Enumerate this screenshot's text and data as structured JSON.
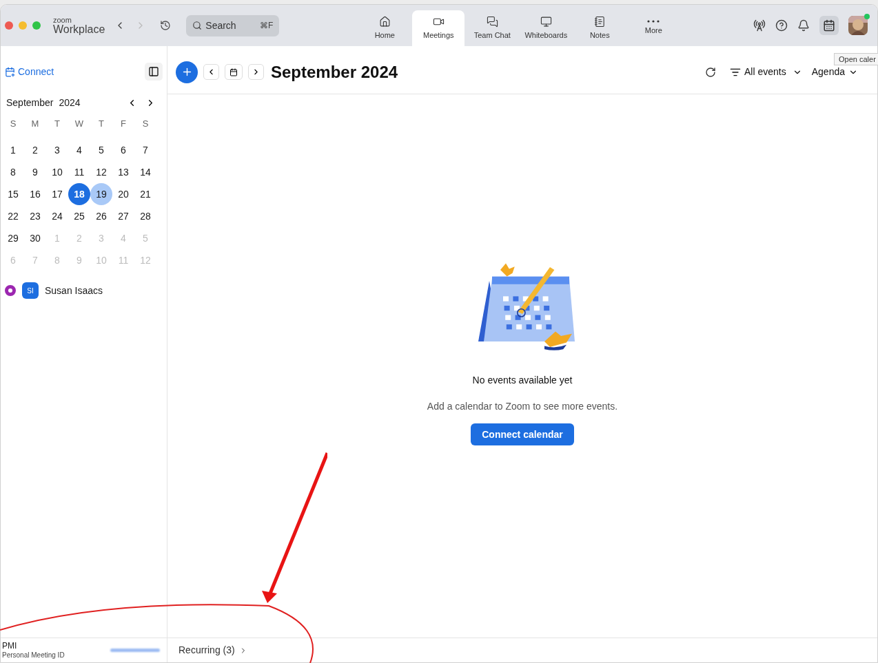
{
  "titlebar": {
    "logo_small": "zoom",
    "logo": "Workplace",
    "search": {
      "placeholder": "Search",
      "shortcut": "⌘F"
    },
    "tabs": [
      {
        "label": "Home",
        "selected": false
      },
      {
        "label": "Meetings",
        "selected": true
      },
      {
        "label": "Team Chat",
        "selected": false
      },
      {
        "label": "Whiteboards",
        "selected": false
      },
      {
        "label": "Notes",
        "selected": false
      },
      {
        "label": "More",
        "selected": false
      }
    ],
    "calendar_button_selected": true,
    "online": true
  },
  "tooltip": "Open caler",
  "sidebar": {
    "connect": "Connect",
    "month": "September",
    "year": "2024",
    "weekdays": [
      "S",
      "M",
      "T",
      "W",
      "T",
      "F",
      "S"
    ],
    "weeks": [
      [
        {
          "label": "1",
          "outside": false,
          "today": false,
          "selected": false
        },
        {
          "label": "2",
          "outside": false,
          "today": false,
          "selected": false
        },
        {
          "label": "3",
          "outside": false,
          "today": false,
          "selected": false
        },
        {
          "label": "4",
          "outside": false,
          "today": false,
          "selected": false
        },
        {
          "label": "5",
          "outside": false,
          "today": false,
          "selected": false
        },
        {
          "label": "6",
          "outside": false,
          "today": false,
          "selected": false
        },
        {
          "label": "7",
          "outside": false,
          "today": false,
          "selected": false
        }
      ],
      [
        {
          "label": "8",
          "outside": false,
          "today": false,
          "selected": false
        },
        {
          "label": "9",
          "outside": false,
          "today": false,
          "selected": false
        },
        {
          "label": "10",
          "outside": false,
          "today": false,
          "selected": false
        },
        {
          "label": "11",
          "outside": false,
          "today": false,
          "selected": false
        },
        {
          "label": "12",
          "outside": false,
          "today": false,
          "selected": false
        },
        {
          "label": "13",
          "outside": false,
          "today": false,
          "selected": false
        },
        {
          "label": "14",
          "outside": false,
          "today": false,
          "selected": false
        }
      ],
      [
        {
          "label": "15",
          "outside": false,
          "today": false,
          "selected": false
        },
        {
          "label": "16",
          "outside": false,
          "today": false,
          "selected": false
        },
        {
          "label": "17",
          "outside": false,
          "today": false,
          "selected": false
        },
        {
          "label": "18",
          "outside": false,
          "today": true,
          "selected": false
        },
        {
          "label": "19",
          "outside": false,
          "today": false,
          "selected": true
        },
        {
          "label": "20",
          "outside": false,
          "today": false,
          "selected": false
        },
        {
          "label": "21",
          "outside": false,
          "today": false,
          "selected": false
        }
      ],
      [
        {
          "label": "22",
          "outside": false,
          "today": false,
          "selected": false
        },
        {
          "label": "23",
          "outside": false,
          "today": false,
          "selected": false
        },
        {
          "label": "24",
          "outside": false,
          "today": false,
          "selected": false
        },
        {
          "label": "25",
          "outside": false,
          "today": false,
          "selected": false
        },
        {
          "label": "26",
          "outside": false,
          "today": false,
          "selected": false
        },
        {
          "label": "27",
          "outside": false,
          "today": false,
          "selected": false
        },
        {
          "label": "28",
          "outside": false,
          "today": false,
          "selected": false
        }
      ],
      [
        {
          "label": "29",
          "outside": false,
          "today": false,
          "selected": false
        },
        {
          "label": "30",
          "outside": false,
          "today": false,
          "selected": false
        },
        {
          "label": "1",
          "outside": true,
          "today": false,
          "selected": false
        },
        {
          "label": "2",
          "outside": true,
          "today": false,
          "selected": false
        },
        {
          "label": "3",
          "outside": true,
          "today": false,
          "selected": false
        },
        {
          "label": "4",
          "outside": true,
          "today": false,
          "selected": false
        },
        {
          "label": "5",
          "outside": true,
          "today": false,
          "selected": false
        }
      ],
      [
        {
          "label": "6",
          "outside": true,
          "today": false,
          "selected": false
        },
        {
          "label": "7",
          "outside": true,
          "today": false,
          "selected": false
        },
        {
          "label": "8",
          "outside": true,
          "today": false,
          "selected": false
        },
        {
          "label": "9",
          "outside": true,
          "today": false,
          "selected": false
        },
        {
          "label": "10",
          "outside": true,
          "today": false,
          "selected": false
        },
        {
          "label": "11",
          "outside": true,
          "today": false,
          "selected": false
        },
        {
          "label": "12",
          "outside": true,
          "today": false,
          "selected": false
        }
      ]
    ],
    "calendars": [
      {
        "initials": "SI",
        "name": "Susan Isaacs",
        "checked": true,
        "color": "#9c27b0"
      }
    ]
  },
  "main": {
    "title": "September 2024",
    "filter": "All events",
    "view": "Agenda",
    "empty_title": "No events available yet",
    "empty_text": "Add a calendar to Zoom to see more events.",
    "connect_button": "Connect calendar"
  },
  "footer": {
    "pmi_label": "PMI",
    "pmi_caption": "Personal Meeting ID",
    "recurring": "Recurring (3)"
  }
}
